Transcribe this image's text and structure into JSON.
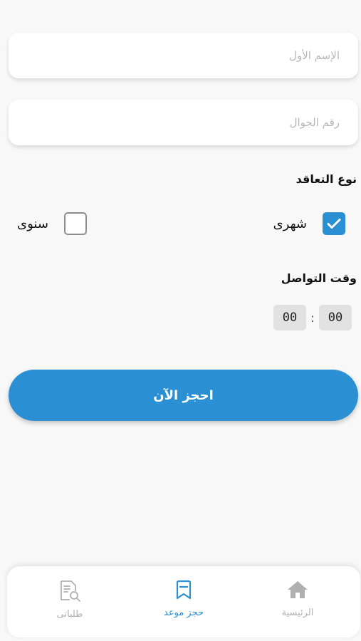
{
  "form": {
    "first_name_placeholder": "الإسم الأول",
    "phone_placeholder": "رقم الجوال",
    "first_name_value": "",
    "phone_value": ""
  },
  "contract": {
    "title": "نوع التعاقد",
    "monthly_label": "شهرى",
    "monthly_checked": true,
    "yearly_label": "سنوى",
    "yearly_checked": false
  },
  "contact_time": {
    "title": "وقت التواصل",
    "hours": "00",
    "separator": ":",
    "minutes": "00"
  },
  "book_button_label": "احجز الآن",
  "bottom_nav": {
    "items": [
      {
        "label": "الرئيسية",
        "icon": "home-icon",
        "active": false
      },
      {
        "label": "حجز موعد",
        "icon": "bookmark-icon",
        "active": true
      },
      {
        "label": "طلباتى",
        "icon": "orders-document-icon",
        "active": false
      }
    ]
  },
  "colors": {
    "accent": "#2b8fd3",
    "background": "#f8f8f8",
    "inactive_nav": "#b0b0b0"
  }
}
